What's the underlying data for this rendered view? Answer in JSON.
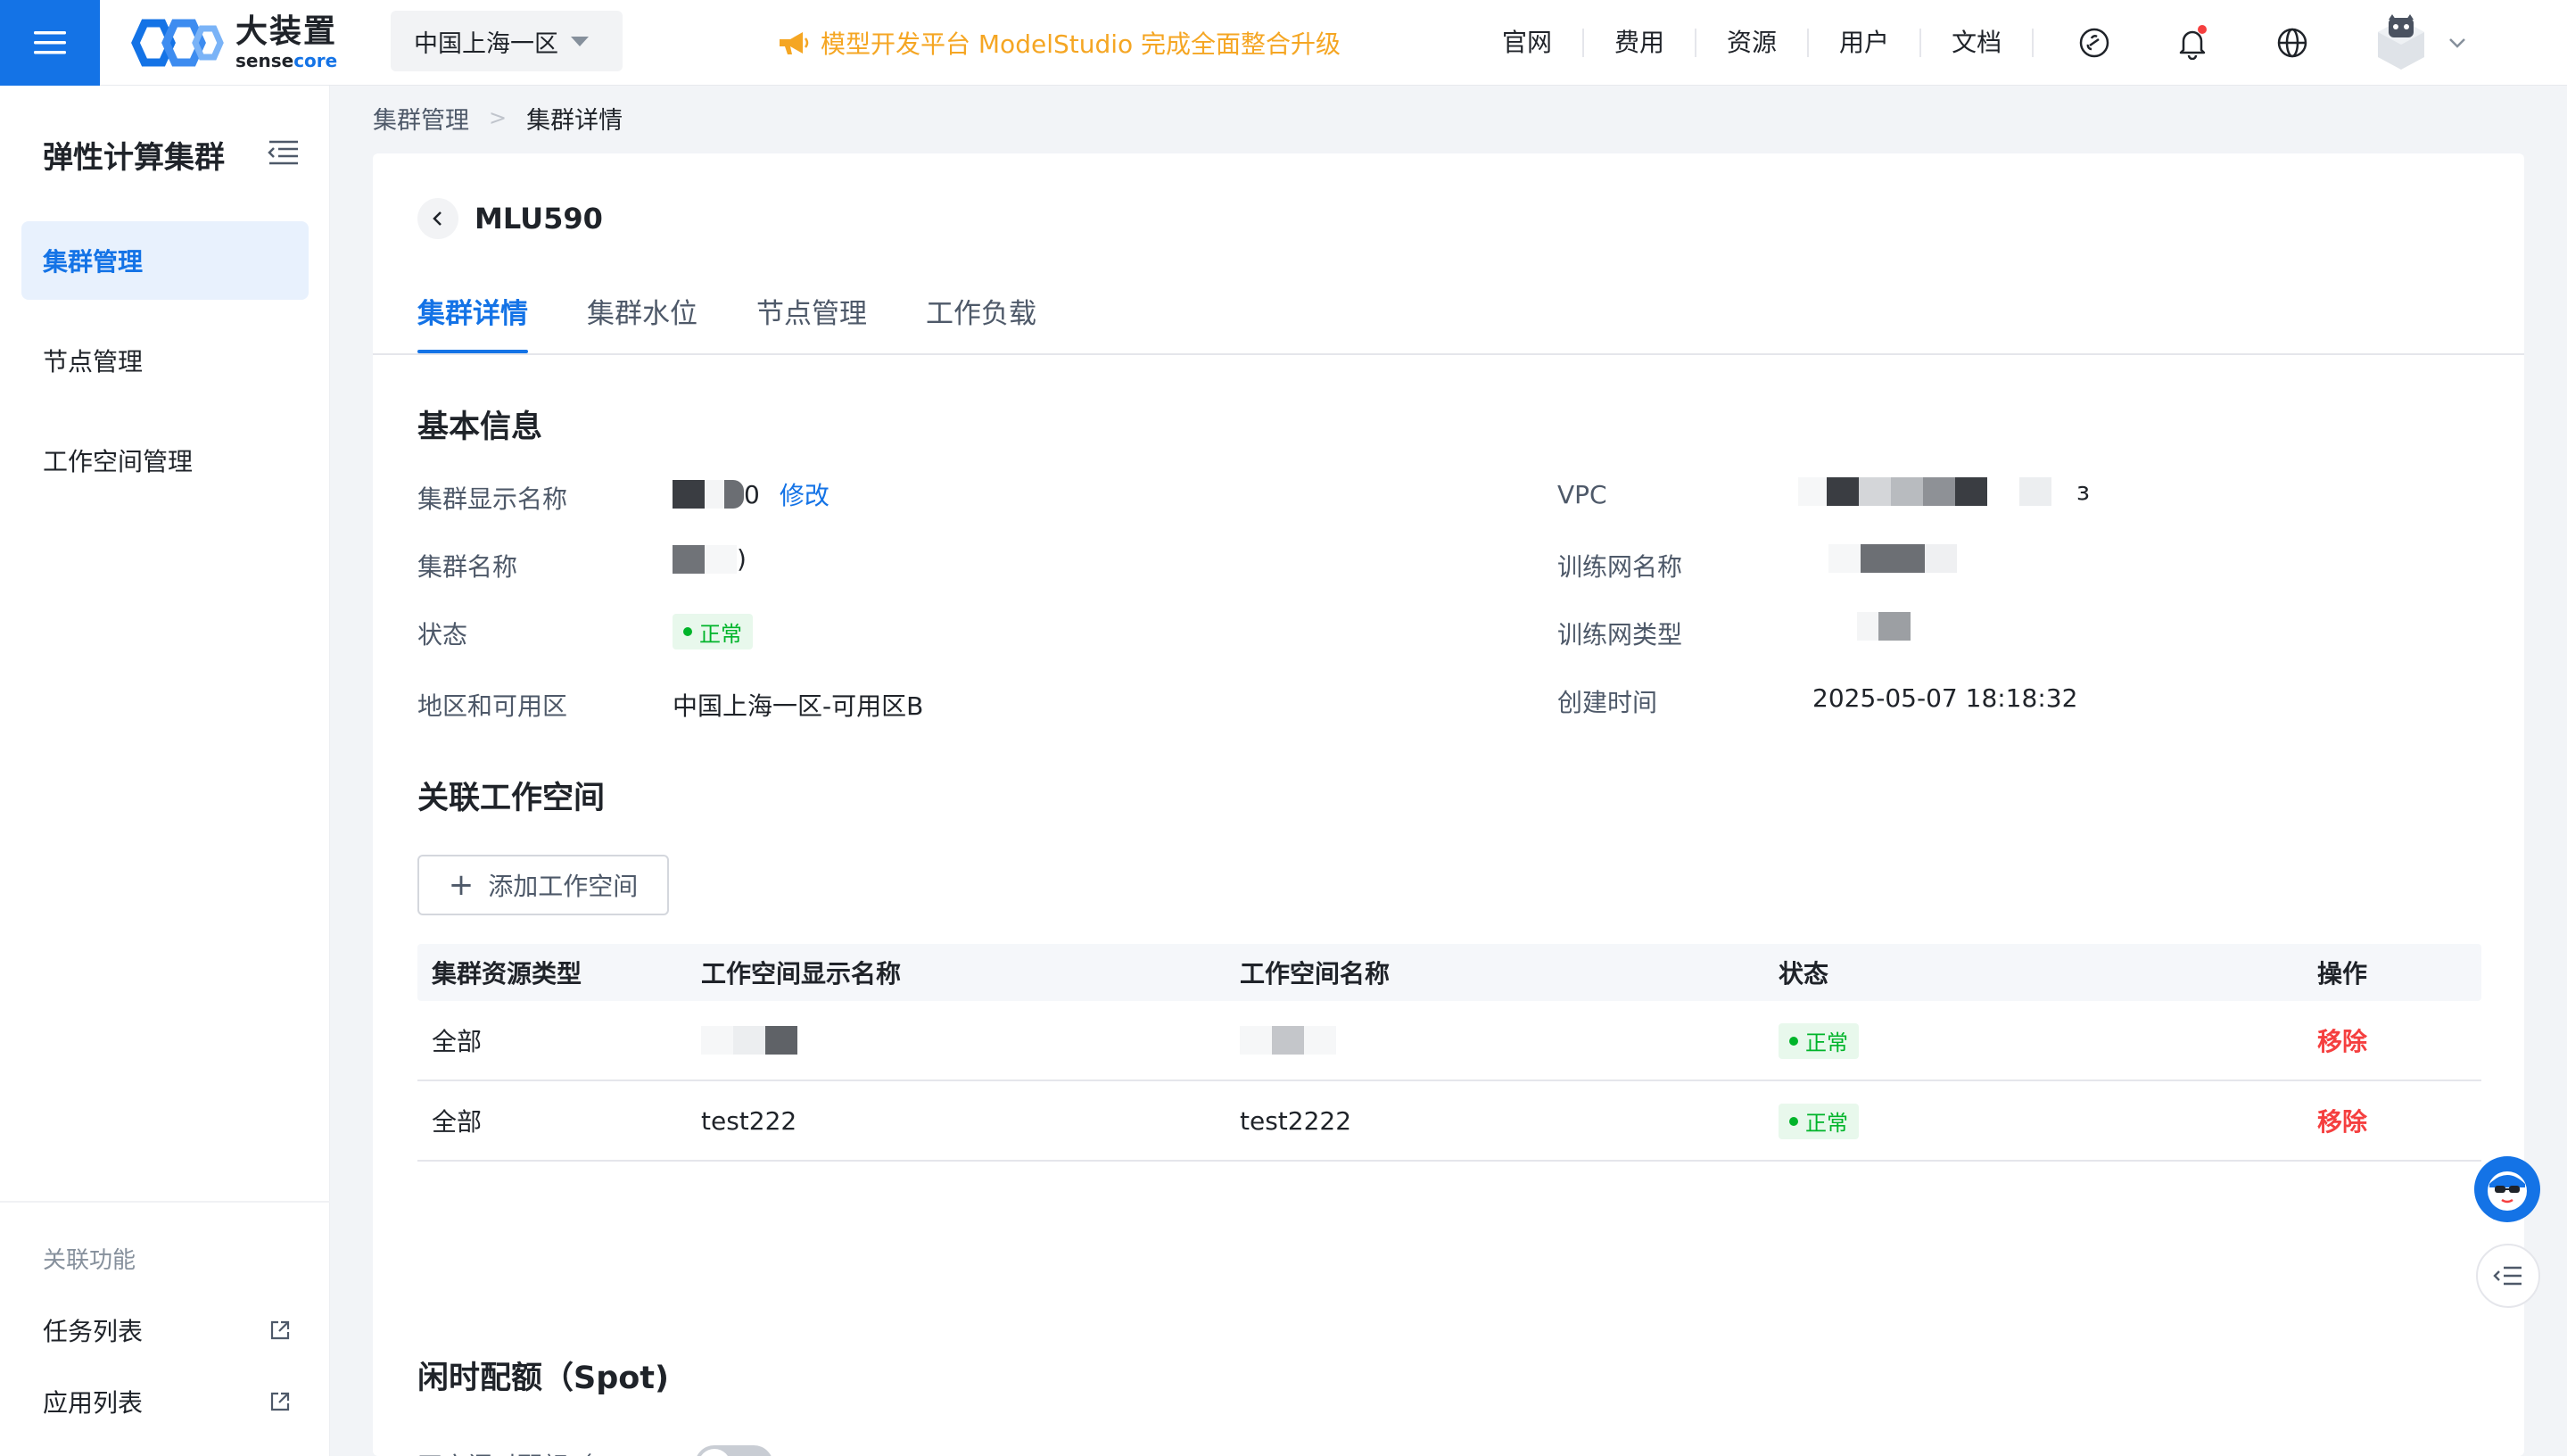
{
  "topbar": {
    "brand_cn": "大装置",
    "brand_en_prefix": "sense",
    "brand_en_suffix": "core",
    "region": "中国上海一区",
    "announcement": "模型开发平台 ModelStudio 完成全面整合升级",
    "nav": [
      "官网",
      "费用",
      "资源",
      "用户",
      "文档"
    ],
    "icons": [
      "menu-icon",
      "chain-icon",
      "bell-icon",
      "globe-icon",
      "avatar-cat",
      "chevron-down-icon"
    ]
  },
  "sidebar": {
    "title": "弹性计算集群",
    "items": [
      {
        "label": "集群管理",
        "active": true
      },
      {
        "label": "节点管理",
        "active": false
      },
      {
        "label": "工作空间管理",
        "active": false
      }
    ],
    "section_title": "关联功能",
    "links": [
      {
        "label": "任务列表"
      },
      {
        "label": "应用列表"
      }
    ]
  },
  "breadcrumb": {
    "parent": "集群管理",
    "separator": ">",
    "current": "集群详情"
  },
  "detail": {
    "title": "MLU590",
    "tabs": [
      "集群详情",
      "集群水位",
      "节点管理",
      "工作负载"
    ],
    "basic_info": {
      "title": "基本信息",
      "display_name_label": "集群显示名称",
      "display_name_tail": "0",
      "edit_label": "修改",
      "name_label": "集群名称",
      "name_tail": ")",
      "status_label": "状态",
      "status_value": "正常",
      "region_label": "地区和可用区",
      "region_value": "中国上海一区-可用区B",
      "vpc_label": "VPC",
      "vpc_tail": "ɜ",
      "train_net_name_label": "训练网名称",
      "train_net_type_label": "训练网类型",
      "created_label": "创建时间",
      "created_value": "2025-05-07 18:18:32"
    },
    "workspaces": {
      "title": "关联工作空间",
      "add_button": "添加工作空间",
      "columns": [
        "集群资源类型",
        "工作空间显示名称",
        "工作空间名称",
        "状态",
        "操作"
      ],
      "rows": [
        {
          "type": "全部",
          "display_name": "",
          "name": "",
          "status": "正常",
          "action": "移除"
        },
        {
          "type": "全部",
          "display_name": "test222",
          "name": "test2222",
          "status": "正常",
          "action": "移除"
        }
      ]
    },
    "spot": {
      "title": "闲时配额（Spot)",
      "toggle_label": "开启闲时配额（Spot)",
      "enabled": false
    }
  },
  "colors": {
    "primary": "#1473e6",
    "announcement": "#f5a623",
    "success": "#00b42a",
    "danger": "#f53f3f"
  }
}
